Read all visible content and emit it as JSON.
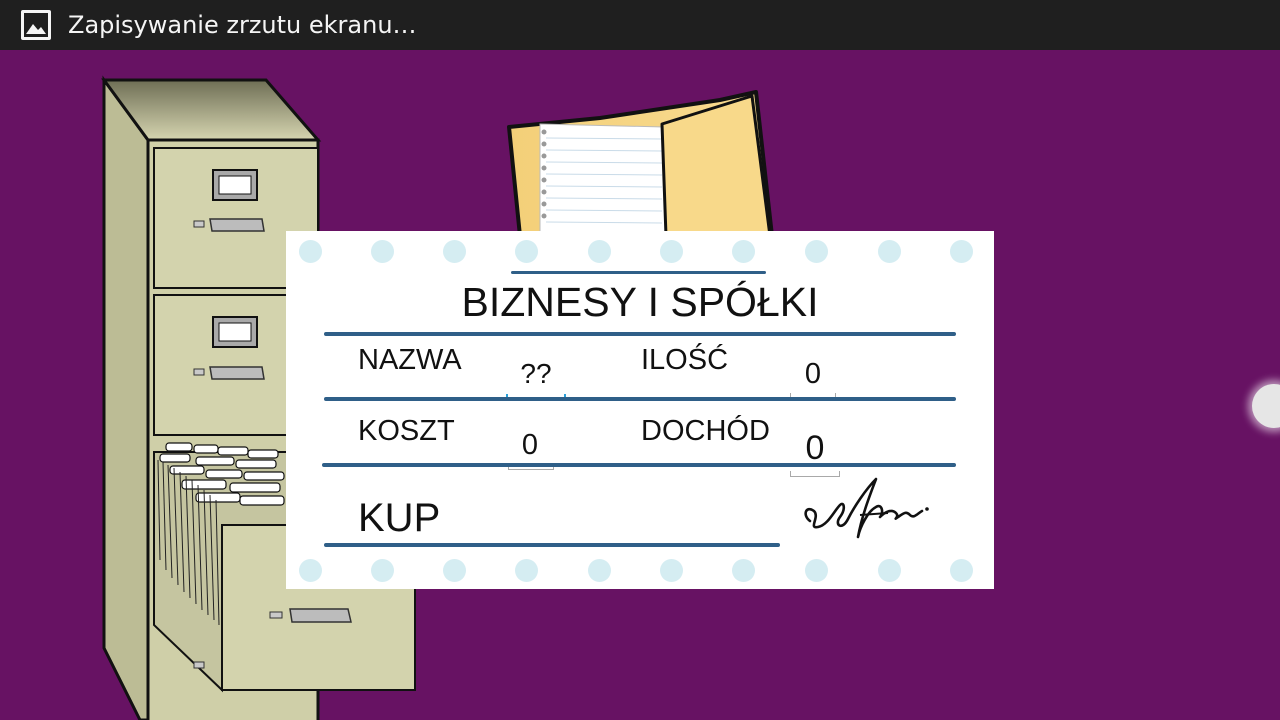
{
  "status_bar": {
    "icon": "image-icon",
    "text": "Zapisywanie zrzutu ekranu…"
  },
  "card": {
    "title": "BIZNESY I SPÓŁKI",
    "fields": {
      "name": {
        "label": "NAZWA",
        "value": "??"
      },
      "quantity": {
        "label": "ILOŚĆ",
        "value": "0"
      },
      "cost": {
        "label": "KOSZT",
        "value": "0"
      },
      "income": {
        "label": "DOCHÓD",
        "value": "0"
      }
    },
    "buy_label": "KUP"
  },
  "icons": [
    "filing-cabinet-icon",
    "folder-icon",
    "signature-icon",
    "side-handle-icon"
  ],
  "colors": {
    "background": "#671263",
    "status_bar": "#1f1f1f",
    "rule": "#2f5f88",
    "dots": "#d5edf2",
    "active_underline": "#2a9fd8"
  }
}
